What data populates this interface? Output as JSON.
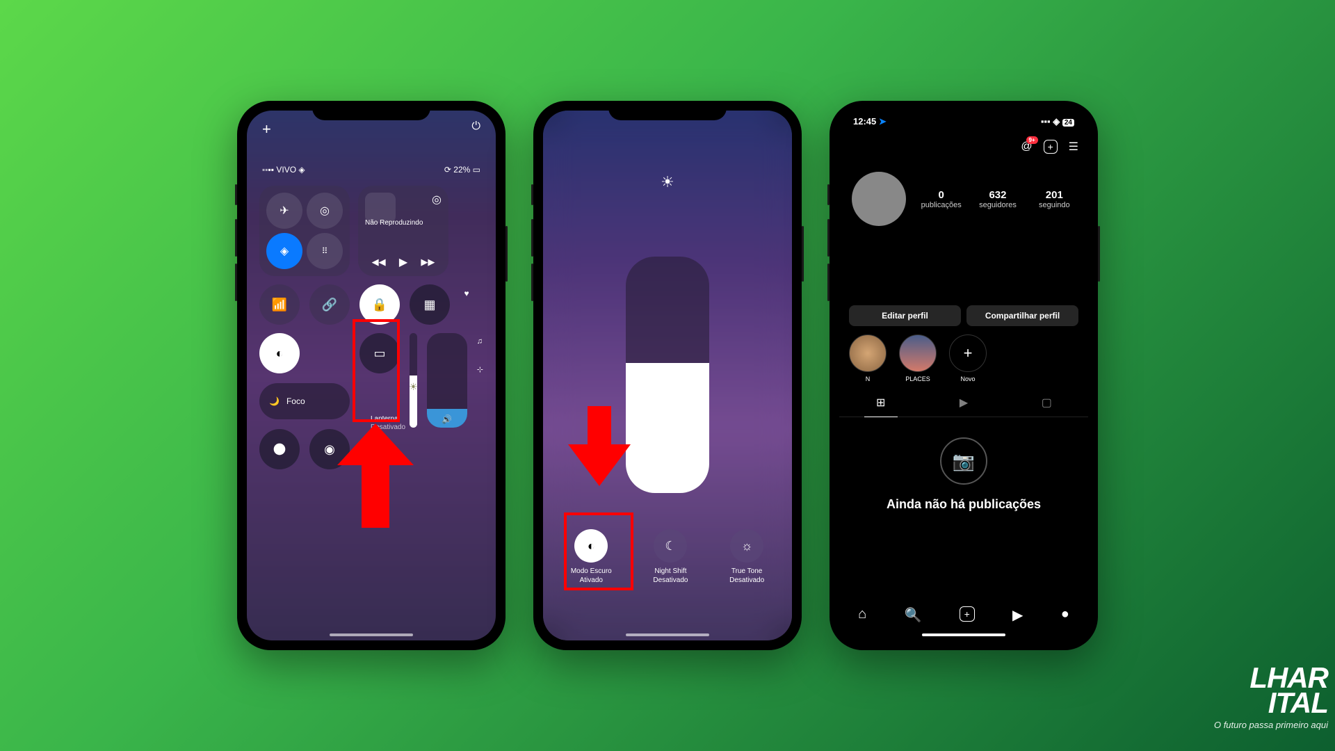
{
  "phone1": {
    "status_carrier": "VIVO",
    "status_battery": "22%",
    "media_label": "Não Reproduzindo",
    "focus_label": "Foco",
    "flashlight_label": "Lanterna",
    "flashlight_state": "Desativado"
  },
  "phone2": {
    "options": [
      {
        "title": "Modo Escuro",
        "state": "Ativado"
      },
      {
        "title": "Night Shift",
        "state": "Desativado"
      },
      {
        "title": "True Tone",
        "state": "Desativado"
      }
    ]
  },
  "phone3": {
    "time": "12:45",
    "battery": "24",
    "threads_badge": "9+",
    "stats": {
      "posts_n": "0",
      "posts_l": "publicações",
      "followers_n": "632",
      "followers_l": "seguidores",
      "following_n": "201",
      "following_l": "seguindo"
    },
    "edit_btn": "Editar perfil",
    "share_btn": "Compartilhar perfil",
    "highlights": [
      {
        "label": "N"
      },
      {
        "label": "PLACES"
      },
      {
        "label": "Novo"
      }
    ],
    "empty_text": "Ainda não há publicações"
  },
  "watermark": {
    "title": "LHAR",
    "title2": "ITAL",
    "sub": "O futuro passa primeiro aqui"
  }
}
